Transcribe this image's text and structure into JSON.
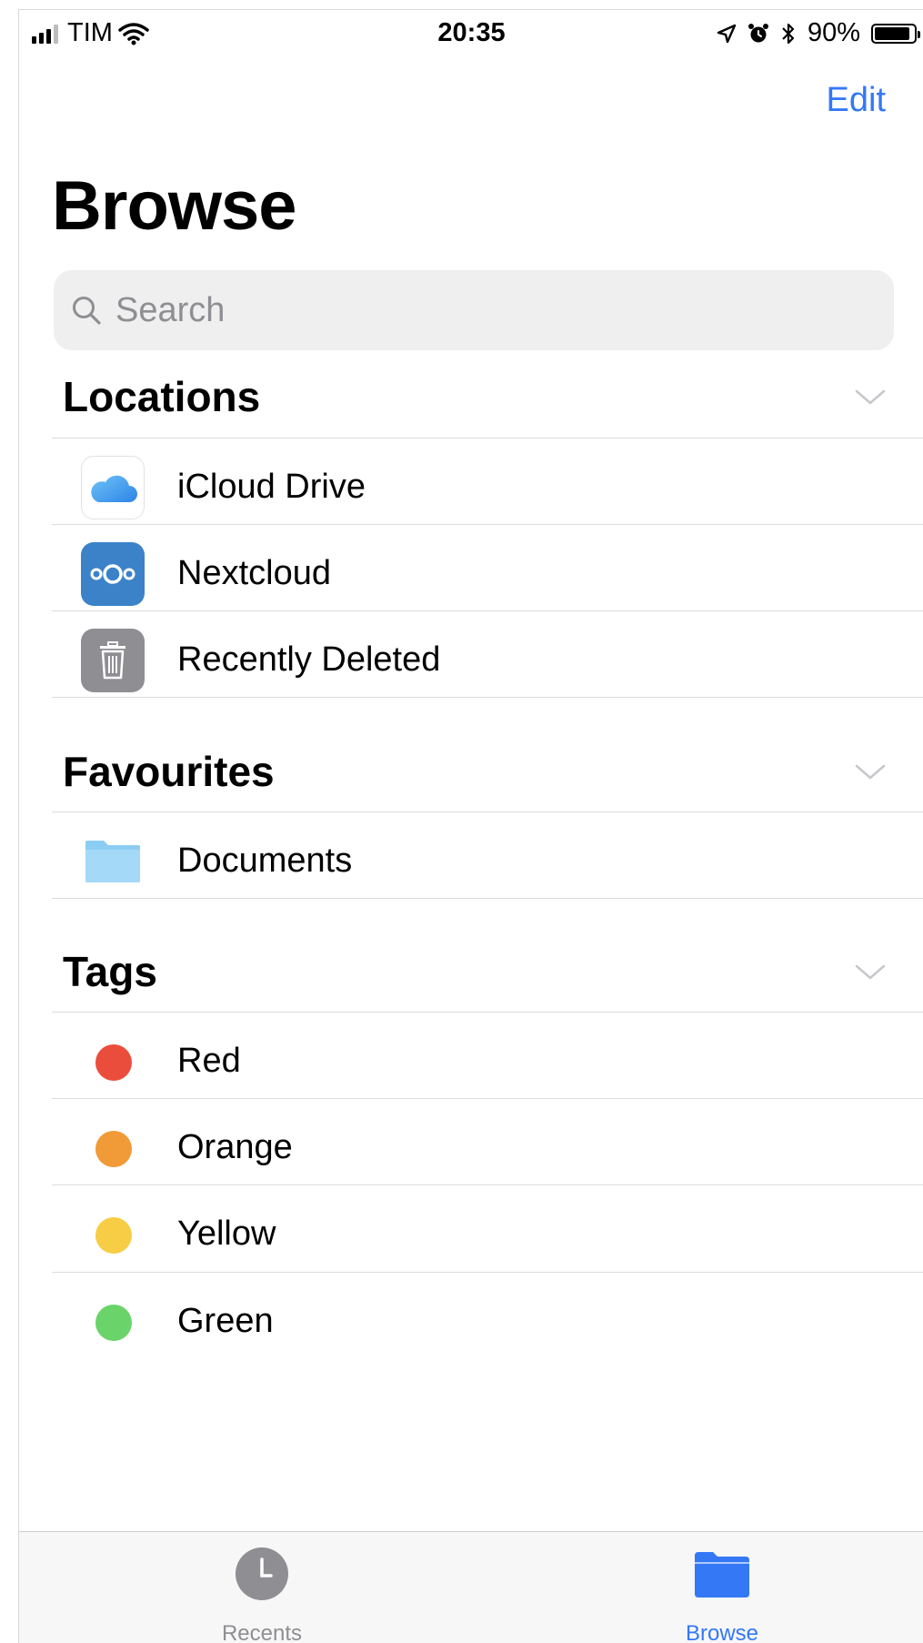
{
  "status_bar": {
    "carrier": "TIM",
    "time": "20:35",
    "battery_percent": "90%",
    "battery_level": 0.9,
    "icons": [
      "signal-icon",
      "wifi-icon",
      "location-icon",
      "alarm-icon",
      "bluetooth-icon",
      "battery-icon"
    ]
  },
  "nav": {
    "edit_label": "Edit"
  },
  "page": {
    "title": "Browse"
  },
  "search": {
    "placeholder": "Search"
  },
  "sections": {
    "locations": {
      "title": "Locations",
      "items": [
        {
          "label": "iCloud Drive",
          "icon": "icloud-icon"
        },
        {
          "label": "Nextcloud",
          "icon": "nextcloud-icon"
        },
        {
          "label": "Recently Deleted",
          "icon": "trash-icon"
        }
      ]
    },
    "favourites": {
      "title": "Favourites",
      "items": [
        {
          "label": "Documents",
          "icon": "folder-icon"
        }
      ]
    },
    "tags": {
      "title": "Tags",
      "items": [
        {
          "label": "Red",
          "color": "#eb4d3d"
        },
        {
          "label": "Orange",
          "color": "#f19a38"
        },
        {
          "label": "Yellow",
          "color": "#f7cd46"
        },
        {
          "label": "Green",
          "color": "#6ad36a"
        }
      ]
    }
  },
  "tab_bar": {
    "tabs": [
      {
        "label": "Recents",
        "icon": "clock-icon",
        "active": false
      },
      {
        "label": "Browse",
        "icon": "folder-icon",
        "active": true
      }
    ],
    "active_color": "#3478f6",
    "inactive_color": "#8e8e93"
  },
  "colors": {
    "accent": "#3478f6"
  }
}
